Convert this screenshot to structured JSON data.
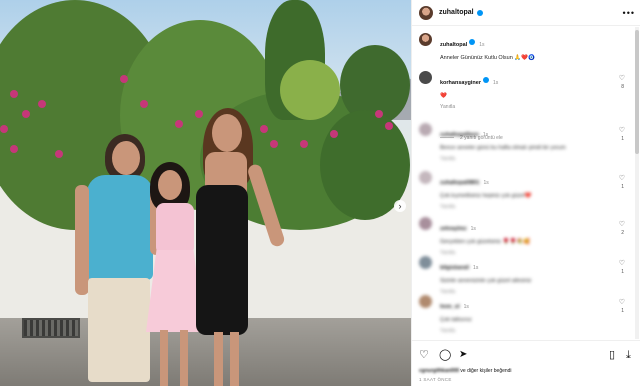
{
  "post": {
    "username": "zuhaltopal",
    "caption_user": "zuhaltopal",
    "caption_time": "1s",
    "caption_text": "Anneler Gününüz Kutlu Olsun",
    "caption_emoji": "🙏❤️🧿"
  },
  "comments": [
    {
      "user": "korhansayginer",
      "time": "1s",
      "text": "❤️",
      "reply": "Yanıtla",
      "likes": "8",
      "blurred": false
    },
    {
      "user": "zuhaltopalfann",
      "time": "1s",
      "text": "Bence anneler günü bu hafta olmalı şimdi bir yorum",
      "reply": "Yanıtla",
      "likes": "1",
      "blurred": true
    },
    {
      "user": "zuhaltopal0801",
      "time": "1s",
      "text": "Çok kıymetlisiniz hepiniz çok güzel❤️",
      "reply": "Yanıtla",
      "likes": "1",
      "blurred": true
    },
    {
      "user": "zehraylmz",
      "time": "1s",
      "text": "Gerçekten çok güzelsiniz 🌹🌹💐🥰",
      "reply": "Yanıtla",
      "likes": "2",
      "blurred": true
    },
    {
      "user": "bilgisbarail",
      "time": "1s",
      "text": "Sizinle annenizinle çok güzel ailesiniz",
      "reply": "Yanıtla",
      "likes": "1",
      "blurred": true
    },
    {
      "user": "hnm_ol",
      "time": "1s",
      "text": "Çok tatlısınız",
      "reply": "Yanıtla",
      "likes": "1",
      "blurred": true
    }
  ],
  "view_replies": "2 yanıtı görüntü ele",
  "likes_line": {
    "names": "cgnurgithkan000",
    "suffix": "ve diğer kişiler beğendi"
  },
  "date": "1 SAAT ÖNCE",
  "icons": {
    "more": "more-options-icon",
    "like": "heart-outline-icon",
    "comment": "comment-icon",
    "share": "share-icon",
    "save": "bookmark-icon",
    "download": "download-icon"
  },
  "colors": {
    "verified": "#0095f6",
    "heart": "#ed4956"
  }
}
